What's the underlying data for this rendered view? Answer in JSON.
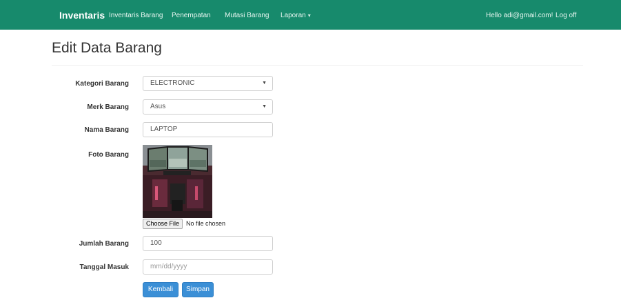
{
  "navbar": {
    "brand": "Inventaris",
    "links": [
      "Inventaris Barang",
      "Penempatan",
      "Mutasi Barang",
      "Laporan"
    ],
    "caret": "▾",
    "greeting": "Hello adi@gmail.com!",
    "logoff": "Log off"
  },
  "page": {
    "title": "Edit Data Barang"
  },
  "form": {
    "kategori": {
      "label": "Kategori Barang",
      "value": "ELECTRONIC",
      "arrow": "▼"
    },
    "merk": {
      "label": "Merk Barang",
      "value": "Asus",
      "arrow": "▼"
    },
    "nama": {
      "label": "Nama Barang",
      "value": "LAPTOP"
    },
    "foto": {
      "label": "Foto Barang",
      "choose_label": "Choose File",
      "status": "No file chosen"
    },
    "jumlah": {
      "label": "Jumlah Barang",
      "value": "100"
    },
    "tanggal": {
      "label": "Tanggal Masuk",
      "placeholder": "mm/dd/yyyy"
    }
  },
  "buttons": {
    "kembali": "Kembali",
    "simpan": "Simpan"
  },
  "colors": {
    "navbar": "#178a6c",
    "primary": "#3b8fd6"
  }
}
